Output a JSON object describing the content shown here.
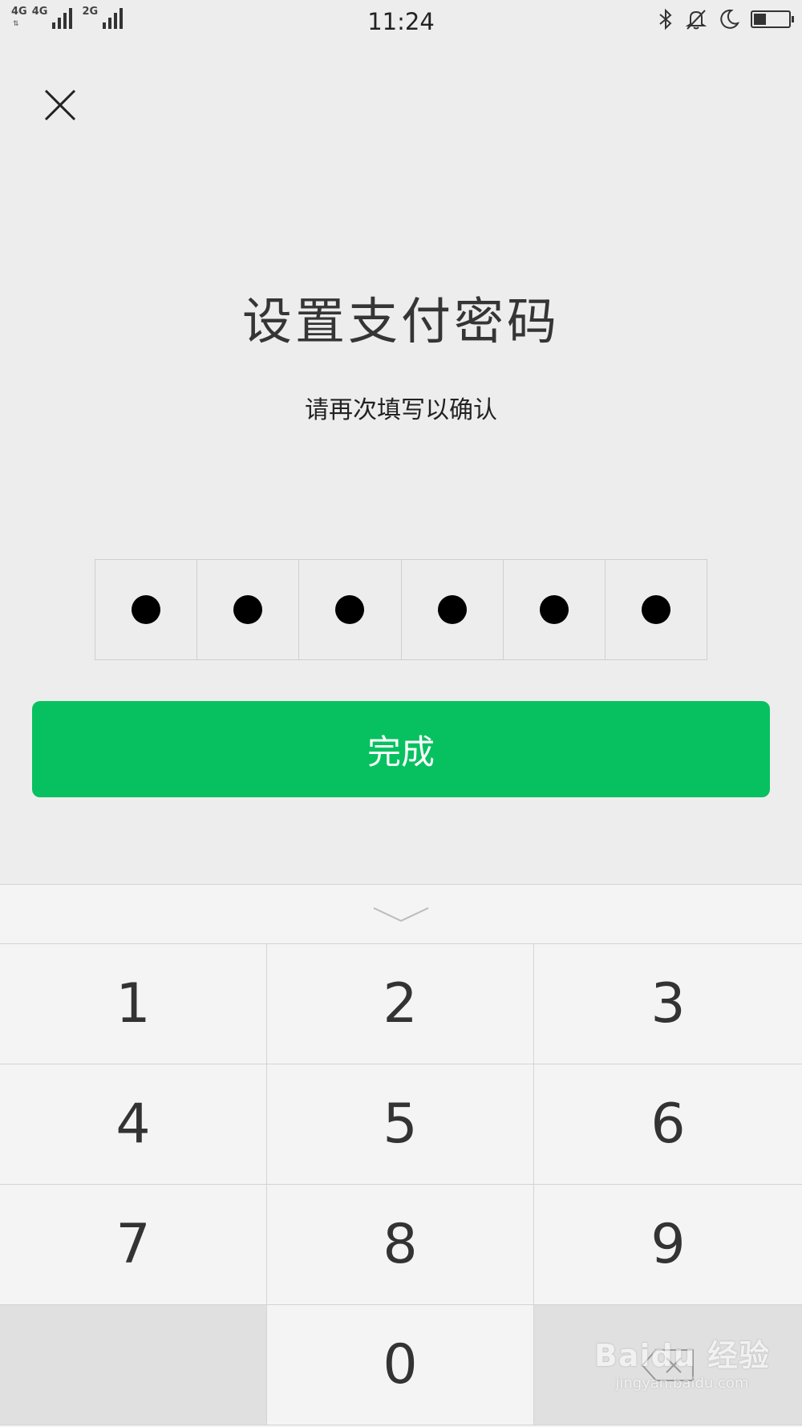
{
  "status_bar": {
    "net1": "4G",
    "net2": "4G",
    "net3": "2G",
    "time": "11:24",
    "battery_level": 0.35
  },
  "close_icon": "close-icon",
  "title": "设置支付密码",
  "subtitle": "请再次填写以确认",
  "pin": {
    "length": 6,
    "filled": 6
  },
  "done_label": "完成",
  "keyboard": {
    "keys": [
      "1",
      "2",
      "3",
      "4",
      "5",
      "6",
      "7",
      "8",
      "9",
      "0"
    ]
  },
  "watermark": {
    "logo": "Baidu 经验",
    "url": "jingyan.baidu.com"
  },
  "colors": {
    "accent": "#07c160",
    "background": "#ededed",
    "keypad": "#f4f4f4"
  }
}
